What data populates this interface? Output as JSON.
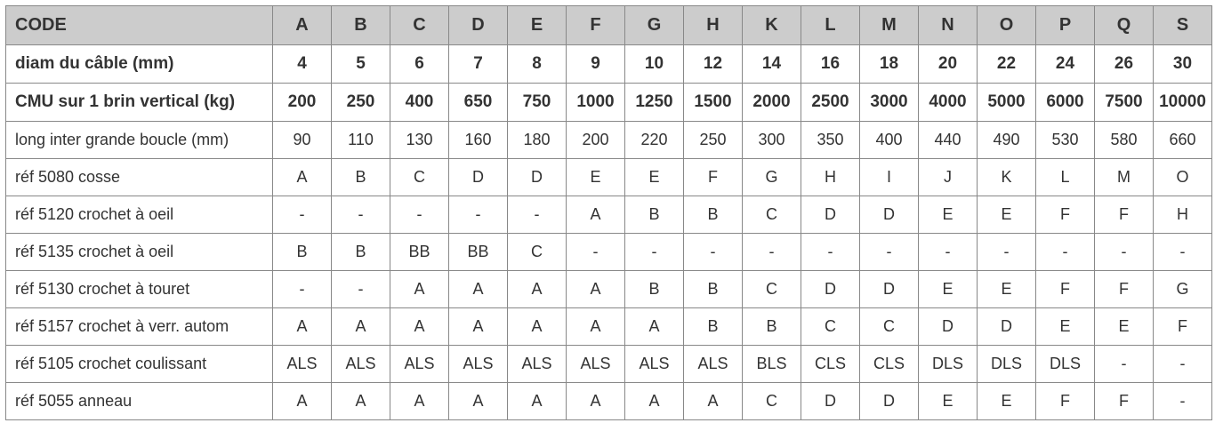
{
  "chart_data": {
    "type": "table",
    "title": "",
    "columns": [
      "CODE",
      "A",
      "B",
      "C",
      "D",
      "E",
      "F",
      "G",
      "H",
      "K",
      "L",
      "M",
      "N",
      "O",
      "P",
      "Q",
      "S"
    ],
    "rows": [
      {
        "label": "diam du câble (mm)",
        "values": [
          "4",
          "5",
          "6",
          "7",
          "8",
          "9",
          "10",
          "12",
          "14",
          "16",
          "18",
          "20",
          "22",
          "24",
          "26",
          "30"
        ],
        "bold": true
      },
      {
        "label": "CMU sur 1 brin vertical (kg)",
        "values": [
          "200",
          "250",
          "400",
          "650",
          "750",
          "1000",
          "1250",
          "1500",
          "2000",
          "2500",
          "3000",
          "4000",
          "5000",
          "6000",
          "7500",
          "10000"
        ],
        "bold": true
      },
      {
        "label": "long inter grande boucle (mm)",
        "values": [
          "90",
          "110",
          "130",
          "160",
          "180",
          "200",
          "220",
          "250",
          "300",
          "350",
          "400",
          "440",
          "490",
          "530",
          "580",
          "660"
        ],
        "bold": false
      },
      {
        "label": "réf 5080 cosse",
        "values": [
          "A",
          "B",
          "C",
          "D",
          "D",
          "E",
          "E",
          "F",
          "G",
          "H",
          "I",
          "J",
          "K",
          "L",
          "M",
          "O"
        ],
        "bold": false
      },
      {
        "label": "réf 5120 crochet à oeil",
        "values": [
          "-",
          "-",
          "-",
          "-",
          "-",
          "A",
          "B",
          "B",
          "C",
          "D",
          "D",
          "E",
          "E",
          "F",
          "F",
          "H"
        ],
        "bold": false
      },
      {
        "label": "réf 5135 crochet à oeil",
        "values": [
          "B",
          "B",
          "BB",
          "BB",
          "C",
          "-",
          "-",
          "-",
          "-",
          "-",
          "-",
          "-",
          "-",
          "-",
          "-",
          "-"
        ],
        "bold": false
      },
      {
        "label": "réf 5130 crochet à touret",
        "values": [
          "-",
          "-",
          "A",
          "A",
          "A",
          "A",
          "B",
          "B",
          "C",
          "D",
          "D",
          "E",
          "E",
          "F",
          "F",
          "G"
        ],
        "bold": false
      },
      {
        "label": "réf 5157 crochet à verr. autom",
        "values": [
          "A",
          "A",
          "A",
          "A",
          "A",
          "A",
          "A",
          "B",
          "B",
          "C",
          "C",
          "D",
          "D",
          "E",
          "E",
          "F"
        ],
        "bold": false
      },
      {
        "label": "réf 5105 crochet coulissant",
        "values": [
          "ALS",
          "ALS",
          "ALS",
          "ALS",
          "ALS",
          "ALS",
          "ALS",
          "ALS",
          "BLS",
          "CLS",
          "CLS",
          "DLS",
          "DLS",
          "DLS",
          "-",
          "-"
        ],
        "bold": false
      },
      {
        "label": "réf 5055 anneau",
        "values": [
          "A",
          "A",
          "A",
          "A",
          "A",
          "A",
          "A",
          "A",
          "C",
          "D",
          "D",
          "E",
          "E",
          "F",
          "F",
          "-"
        ],
        "bold": false
      }
    ]
  }
}
